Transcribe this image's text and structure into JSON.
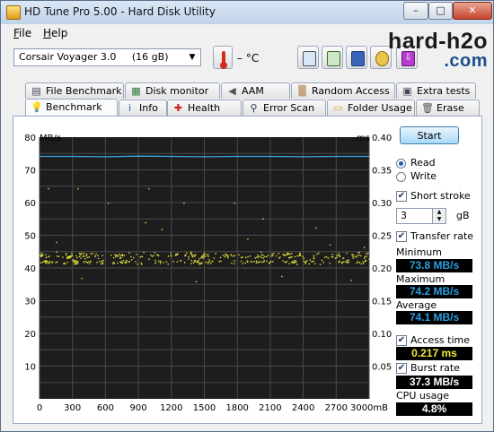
{
  "window": {
    "title": "HD Tune Pro 5.00 - Hard Disk Utility",
    "minimize": "–",
    "maximize": "□",
    "close": "✕"
  },
  "menu": {
    "file_accel": "F",
    "file_rest": "ile",
    "help_accel": "H",
    "help_rest": "elp"
  },
  "toolbar": {
    "drive": "Corsair Voyager 3.0     (16 gB)",
    "temperature": "– °C"
  },
  "watermark": {
    "line1": "hard-h2o",
    "line2": ".com"
  },
  "tabs_top": [
    {
      "label": "File Benchmark",
      "icon": "file-benchmark-icon"
    },
    {
      "label": "Disk monitor",
      "icon": "disk-monitor-icon"
    },
    {
      "label": "AAM",
      "icon": "speaker-icon"
    },
    {
      "label": "Random Access",
      "icon": "random-access-icon"
    },
    {
      "label": "Extra tests",
      "icon": "extra-tests-icon"
    }
  ],
  "tabs_bottom": [
    {
      "label": "Benchmark",
      "icon": "lightbulb-icon",
      "active": true
    },
    {
      "label": "Info",
      "icon": "info-icon"
    },
    {
      "label": "Health",
      "icon": "health-cross-icon"
    },
    {
      "label": "Error Scan",
      "icon": "magnifier-icon"
    },
    {
      "label": "Folder Usage",
      "icon": "folder-icon"
    },
    {
      "label": "Erase",
      "icon": "trash-icon"
    }
  ],
  "controls": {
    "start": "Start",
    "read": "Read",
    "write": "Write",
    "mode": "read",
    "short_stroke_label": "Short stroke",
    "short_stroke_checked": true,
    "short_stroke_value": "3",
    "short_stroke_unit": "gB",
    "transfer_rate_label": "Transfer rate",
    "transfer_rate_checked": true,
    "access_time_label": "Access time",
    "access_time_checked": true,
    "burst_rate_label": "Burst rate",
    "burst_rate_checked": true
  },
  "results": {
    "minimum_label": "Minimum",
    "minimum": "73.8 MB/s",
    "maximum_label": "Maximum",
    "maximum": "74.2 MB/s",
    "average_label": "Average",
    "average": "74.1 MB/s",
    "access_time": "0.217 ms",
    "burst_rate": "37.3 MB/s",
    "cpu_usage_label": "CPU usage",
    "cpu_usage": "4.8%"
  },
  "colors": {
    "transfer": "#3aa6e6",
    "access": "#e4e23a",
    "stat_blue": "#2a9fe0",
    "stat_yellow": "#f0ea3a",
    "stat_white": "#ffffff",
    "chart_bg": "#1d1d1d",
    "grid": "#4a4a4a"
  },
  "chart_data": {
    "type": "scatter",
    "ylabel_left": "MB/s",
    "ylabel_right": "ms",
    "x_unit": "mB",
    "x_ticks": [
      "0",
      "300",
      "600",
      "900",
      "1200",
      "1500",
      "1800",
      "2100",
      "2400",
      "2700",
      "3000mB"
    ],
    "y_left_ticks": [
      "80",
      "70",
      "60",
      "50",
      "40",
      "30",
      "20",
      "10"
    ],
    "y_right_ticks": [
      "0.40",
      "0.35",
      "0.30",
      "0.25",
      "0.20",
      "0.15",
      "0.10",
      "0.05"
    ],
    "xlim": [
      0,
      3000
    ],
    "ylim_left": [
      0,
      80
    ],
    "ylim_right": [
      0,
      0.4
    ],
    "grid": true,
    "series": [
      {
        "name": "Transfer rate",
        "axis": "left",
        "type": "line",
        "x": [
          0,
          300,
          600,
          900,
          1200,
          1500,
          1800,
          2100,
          2400,
          2700,
          3000
        ],
        "values": [
          74.1,
          74.1,
          74.0,
          74.2,
          74.1,
          74.0,
          74.1,
          74.1,
          74.0,
          74.1,
          74.1
        ]
      },
      {
        "name": "Access time",
        "axis": "right",
        "type": "scatter",
        "clusters": [
          {
            "center_ms": 0.22,
            "spread_ms": 0.006,
            "count": 230
          },
          {
            "center_ms": 0.21,
            "spread_ms": 0.004,
            "count": 190
          }
        ],
        "outliers": [
          {
            "x": 75,
            "y": 0.322
          },
          {
            "x": 345,
            "y": 0.322
          },
          {
            "x": 620,
            "y": 0.3
          },
          {
            "x": 990,
            "y": 0.322
          },
          {
            "x": 1310,
            "y": 0.3
          },
          {
            "x": 960,
            "y": 0.27
          },
          {
            "x": 1110,
            "y": 0.26
          },
          {
            "x": 1770,
            "y": 0.3
          },
          {
            "x": 2030,
            "y": 0.276
          },
          {
            "x": 2510,
            "y": 0.262
          },
          {
            "x": 2950,
            "y": 0.232
          },
          {
            "x": 380,
            "y": 0.185
          },
          {
            "x": 1420,
            "y": 0.18
          },
          {
            "x": 2200,
            "y": 0.188
          },
          {
            "x": 2830,
            "y": 0.182
          },
          {
            "x": 150,
            "y": 0.24
          },
          {
            "x": 1890,
            "y": 0.245
          },
          {
            "x": 2640,
            "y": 0.236
          }
        ]
      }
    ]
  }
}
